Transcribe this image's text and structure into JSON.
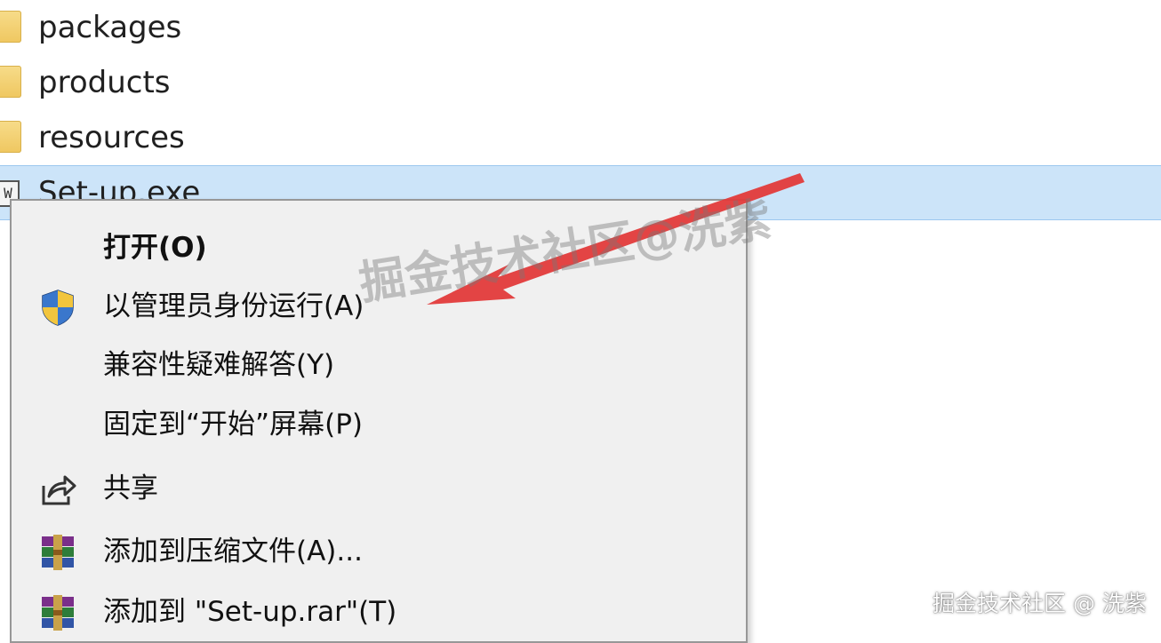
{
  "files": [
    {
      "name": "packages",
      "icon": "folder-icon"
    },
    {
      "name": "products",
      "icon": "folder-icon"
    },
    {
      "name": "resources",
      "icon": "folder-icon"
    },
    {
      "name": "Set-up.exe",
      "icon": "exe-icon"
    }
  ],
  "exe_icon_glyph": "W",
  "context_menu": {
    "items": [
      {
        "label": "打开(O)",
        "icon": null,
        "bold": true
      },
      {
        "label": "以管理员身份运行(A)",
        "icon": "uac-shield-icon"
      },
      {
        "label": "兼容性疑难解答(Y)",
        "icon": null
      },
      {
        "label": "固定到“开始”屏幕(P)",
        "icon": null
      },
      {
        "label": "共享",
        "icon": "share-icon"
      },
      {
        "label": "添加到压缩文件(A)...",
        "icon": "winrar-icon"
      },
      {
        "label": "添加到 \"Set-up.rar\"(T)",
        "icon": "winrar-icon"
      }
    ]
  },
  "watermark_center": "掘金技术社区@洗紫",
  "watermark_corner": "掘金技术社区 @ 洗紫",
  "colors": {
    "selection": "#cce4f9",
    "menu_background": "#f0f0f0",
    "arrow": "#e23a3a"
  }
}
